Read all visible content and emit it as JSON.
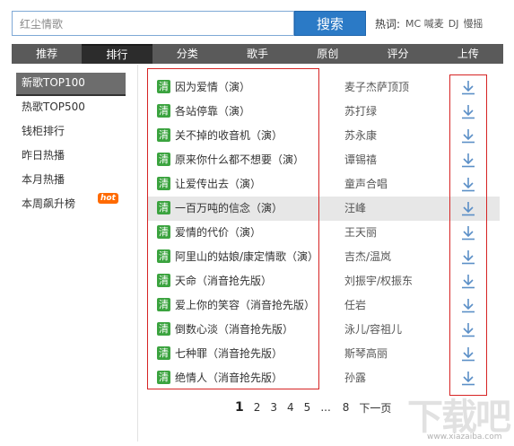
{
  "search": {
    "value": "红尘情歌",
    "button_label": "搜索"
  },
  "hotwords": {
    "label": "热词:",
    "items": [
      "MC 喊麦",
      "DJ",
      "慢摇"
    ]
  },
  "nav": {
    "tabs": [
      "推荐",
      "排行",
      "分类",
      "歌手",
      "原创",
      "评分",
      "上传"
    ]
  },
  "sidebar": {
    "items": [
      "新歌TOP100",
      "热歌TOP500",
      "钱柜排行",
      "昨日热播",
      "本月热播",
      "本周飙升榜"
    ],
    "hot_badge": "hot"
  },
  "songs": {
    "badge": "清",
    "items": [
      {
        "title": "因为爱情（演）",
        "artist": "麦子杰萨顶顶"
      },
      {
        "title": "各站停靠（演）",
        "artist": "苏打绿"
      },
      {
        "title": "关不掉的收音机（演）",
        "artist": "苏永康"
      },
      {
        "title": "原来你什么都不想要（演）",
        "artist": "谭锡禧"
      },
      {
        "title": "让爱传出去（演）",
        "artist": "童声合唱"
      },
      {
        "title": "一百万吨的信念（演）",
        "artist": "汪峰"
      },
      {
        "title": "爱情的代价（演）",
        "artist": "王天丽"
      },
      {
        "title": "阿里山的姑娘/康定情歌（演）",
        "artist": "吉杰/温岚"
      },
      {
        "title": "天命（消音抢先版）",
        "artist": "刘振宇/权振东"
      },
      {
        "title": "爱上你的笑容（消音抢先版）",
        "artist": "任岩"
      },
      {
        "title": "倒数心淡（消音抢先版）",
        "artist": "泳儿/容祖儿"
      },
      {
        "title": "七种罪（消音抢先版）",
        "artist": "斯琴高丽"
      },
      {
        "title": "绝情人（消音抢先版）",
        "artist": "孙露"
      }
    ]
  },
  "pagination": {
    "pages": [
      "1",
      "2",
      "3",
      "4",
      "5"
    ],
    "ellipsis": "...",
    "last": "8",
    "next": "下一页"
  },
  "watermark": {
    "text": "下载吧",
    "url": "www.xiazaiba.com"
  },
  "colors": {
    "search_button": "#2b7ac6",
    "nav_bg": "#5a5a5a",
    "nav_active": "#2c2c2c",
    "badge_green": "#3ba33f",
    "highlight_box": "#d62424",
    "download_icon": "#5b8fc7",
    "hot_badge": "#ff6a00"
  },
  "icons": {
    "download": "download-arrow-icon",
    "hot": "hot-badge-icon"
  }
}
